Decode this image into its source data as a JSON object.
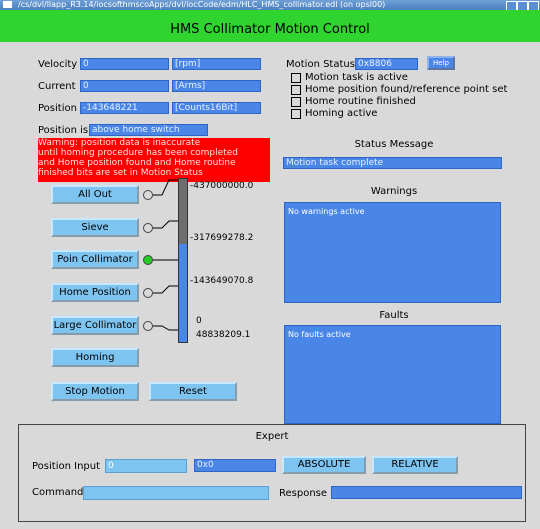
{
  "window": {
    "title": "/cs/dvl/llapp_R3.14/iocsofthmscoApps/dvl/iocCode/edm/HLC_HMS_collimator.edl (on opsl00)"
  },
  "app": {
    "title": "HMS Collimator Motion Control"
  },
  "readbacks": {
    "velocity": {
      "label": "Velocity",
      "value": "0",
      "unit": "[rpm]"
    },
    "current": {
      "label": "Current",
      "value": "0",
      "unit": "[Arms]"
    },
    "position": {
      "label": "Position",
      "value": "-143648221",
      "unit": "[Counts16Bit]"
    }
  },
  "position_is": {
    "label": "Position is",
    "value": "above home switch"
  },
  "warning_banner": [
    "Warning: position data is inaccurate",
    "until homing procedure has been completed",
    "and Home position found and Home routine",
    "finished bits are set in Motion Status"
  ],
  "motion_status": {
    "label": "Motion Status",
    "value": "0x8806",
    "help": "Help",
    "bits": [
      "Motion task is active",
      "Home position found/reference point set",
      "Home routine finished",
      "Homing active"
    ]
  },
  "status_message": {
    "title": "Status Message",
    "value": "Motion task complete"
  },
  "warnings": {
    "title": "Warnings",
    "text": "No warnings active"
  },
  "faults": {
    "title": "Faults",
    "text": "No faults active"
  },
  "positions": [
    {
      "label": "All Out",
      "active": false
    },
    {
      "label": "Sieve",
      "active": false
    },
    {
      "label": "Poin Collimator",
      "active": true
    },
    {
      "label": "Home Position",
      "active": false
    },
    {
      "label": "Large Collimator",
      "active": false
    }
  ],
  "scale": {
    "ticks": [
      "-437000000.0",
      "-317699278.2",
      "-143649070.8",
      "0",
      "48838209.1"
    ],
    "min": -437000000.0,
    "max": 48838209.1,
    "value": -143648221,
    "colors": {
      "upper": "#6e6e6e",
      "lower": "#4a86e8"
    }
  },
  "buttons": {
    "homing": "Homing",
    "stop": "Stop Motion",
    "reset": "Reset"
  },
  "expert": {
    "title": "Expert",
    "position_input_label": "Position Input",
    "position_input_value": "0",
    "hex_value": "0x0",
    "absolute": "ABSOLUTE",
    "relative": "RELATIVE",
    "command_label": "Command",
    "command_value": "",
    "response_label": "Response",
    "response_value": ""
  },
  "colors": {
    "accent_green": "#2fd42f",
    "field_blue": "#4a86e8",
    "button_blue": "#7ec4f0",
    "warning_red": "#ff0000",
    "led_on": "#22cc22"
  }
}
